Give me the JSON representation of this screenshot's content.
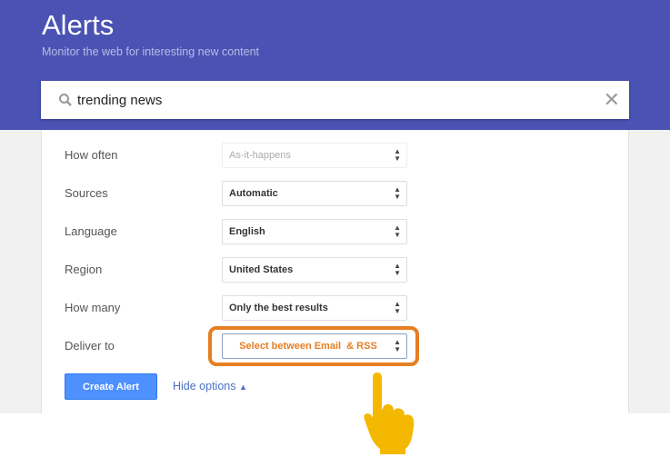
{
  "header": {
    "title": "Alerts",
    "subtitle": "Monitor the web for interesting new content"
  },
  "search": {
    "value": "trending news",
    "icon": "search-icon",
    "clear_icon": "close-icon",
    "clear_glyph": "✕"
  },
  "options": [
    {
      "label": "How often",
      "value": "As-it-happens",
      "disabled": true
    },
    {
      "label": "Sources",
      "value": "Automatic"
    },
    {
      "label": "Language",
      "value": "English"
    },
    {
      "label": "Region",
      "value": "United States"
    },
    {
      "label": "How many",
      "value": "Only the best results"
    },
    {
      "label": "Deliver to",
      "value": "Select between Email  & RSS",
      "highlighted": true
    }
  ],
  "arrow_glyph": "▲\n▼",
  "actions": {
    "create": "Create Alert",
    "hide": "Hide options",
    "hide_glyph": "▲"
  },
  "colors": {
    "header": "#4a52b3",
    "button": "#4d90fe",
    "highlight": "#e67e22",
    "hand": "#f5b800"
  }
}
